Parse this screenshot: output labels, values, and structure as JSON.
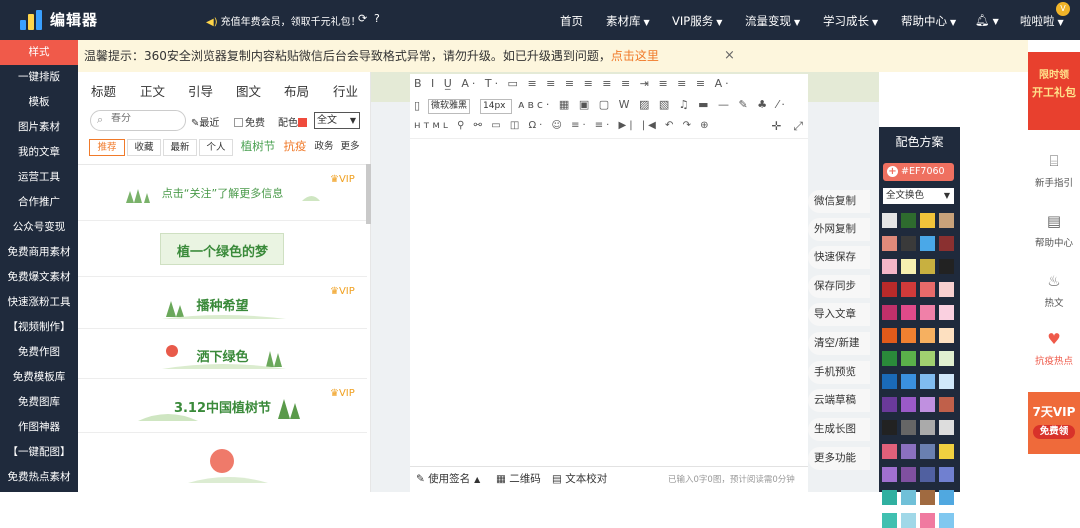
{
  "header": {
    "logo_text": "编辑器",
    "promo": "充值年费会员，领取千元礼包！",
    "nav": [
      "首页",
      "素材库",
      "VIP服务",
      "流量变现",
      "学习成长",
      "帮助中心"
    ],
    "user": "啦啦啦",
    "avatar_badge": "V"
  },
  "sidebar": {
    "items": [
      "样式",
      "一键排版",
      "模板",
      "图片素材",
      "我的文章",
      "运营工具",
      "合作推广",
      "公众号变现",
      "免费商用素材",
      "免费爆文素材",
      "快速涨粉工具",
      "【视频制作】",
      "免费作图",
      "免费模板库",
      "免费图库",
      "作图神器",
      "【一键配图】",
      "免费热点素材"
    ]
  },
  "notice": {
    "text": "温馨提示：360安全浏览器复制内容粘贴微信后台会导致格式异常，请勿升级。如已升级遇到问题，",
    "link": "点击这里",
    "close": "×"
  },
  "template_panel": {
    "tabs": [
      "标题",
      "正文",
      "引导",
      "图文",
      "布局",
      "行业"
    ],
    "search_placeholder": "春分",
    "recent": "最近",
    "free": "免费",
    "color_label": "配色",
    "scope": "全文",
    "categories": [
      "推荐",
      "收藏",
      "最新",
      "个人",
      "植树节",
      "抗疫",
      "政务",
      "更多"
    ],
    "cards": [
      {
        "title": "点击“关注”了解更多信息",
        "vip": true
      },
      {
        "title": "植一个绿色的梦",
        "vip": false
      },
      {
        "title": "播种希望",
        "vip": true
      },
      {
        "title": "洒下绿色",
        "vip": false
      },
      {
        "title": "3.12中国植树节",
        "vip": true
      },
      {
        "title": "",
        "vip": false
      }
    ],
    "vip_label": "VIP"
  },
  "editor": {
    "font_family": "微软雅黑",
    "font_size": "14px",
    "status": {
      "signature": "使用签名",
      "qrcode": "二维码",
      "proofread": "文本校对",
      "count": "已输入0字0图，预计阅读需0分钟"
    },
    "actions": [
      "微信复制",
      "外网复制",
      "快速保存",
      "保存同步",
      "导入文章",
      "清空/新建",
      "手机预览",
      "云端草稿",
      "生成长图",
      "更多功能"
    ]
  },
  "color_scheme": {
    "title": "配色方案",
    "current": "#EF7060",
    "mode": "全文换色",
    "swatches": [
      [
        "#e6e6e6",
        "#2e6b2e",
        "#f2c43a",
        "#c8a27a"
      ],
      [
        "#e08a7a",
        "#3a3a3a",
        "#4aa8e8",
        "#8a3030"
      ],
      [
        "#f3b6c8",
        "#f6f0b0",
        "#c8b040",
        "#222222"
      ],
      [
        "#b82a2a",
        "#d03a3a",
        "#e86a6a",
        "#f8d0d0"
      ],
      [
        "#c0306a",
        "#e04a8a",
        "#f080a8",
        "#fad0e0"
      ],
      [
        "#e05a1a",
        "#f08030",
        "#f6b060",
        "#fde0c0"
      ],
      [
        "#2a8a3a",
        "#5ab04a",
        "#a0d070",
        "#e0f0d0"
      ],
      [
        "#1a6ab8",
        "#3a90e0",
        "#80bcf0",
        "#d0e8fa"
      ],
      [
        "#6a3a9a",
        "#9a5ac8",
        "#c090e0",
        "#c0604a"
      ],
      [
        "#222222",
        "#666666",
        "#aaaaaa",
        "#dddddd"
      ],
      [
        "#e0607a",
        "#8a70c0",
        "#6a80b0",
        "#f0d040"
      ],
      [
        "#a070d0",
        "#8050a0",
        "#5060a0",
        "#7080d0"
      ],
      [
        "#30b0a0",
        "#70c0d8",
        "#a06a40",
        "#50a8e0"
      ],
      [
        "#40c0b0",
        "#a0d8e8",
        "#f07aa0",
        "#80c8f0"
      ]
    ]
  },
  "right_panel": {
    "top_banner": [
      "限时领",
      "开工礼包"
    ],
    "items": [
      "新手指引",
      "帮助中心",
      "热文",
      "抗疫热点"
    ],
    "bottom_banner": [
      "7天VIP",
      "免费领"
    ]
  },
  "colors": {
    "dark_bg": "#1f2a3c",
    "accent": "#ef7060",
    "active_red": "#f05a4a",
    "notice_bg": "#fdf6dd",
    "green_title": "#3a8a3a"
  }
}
